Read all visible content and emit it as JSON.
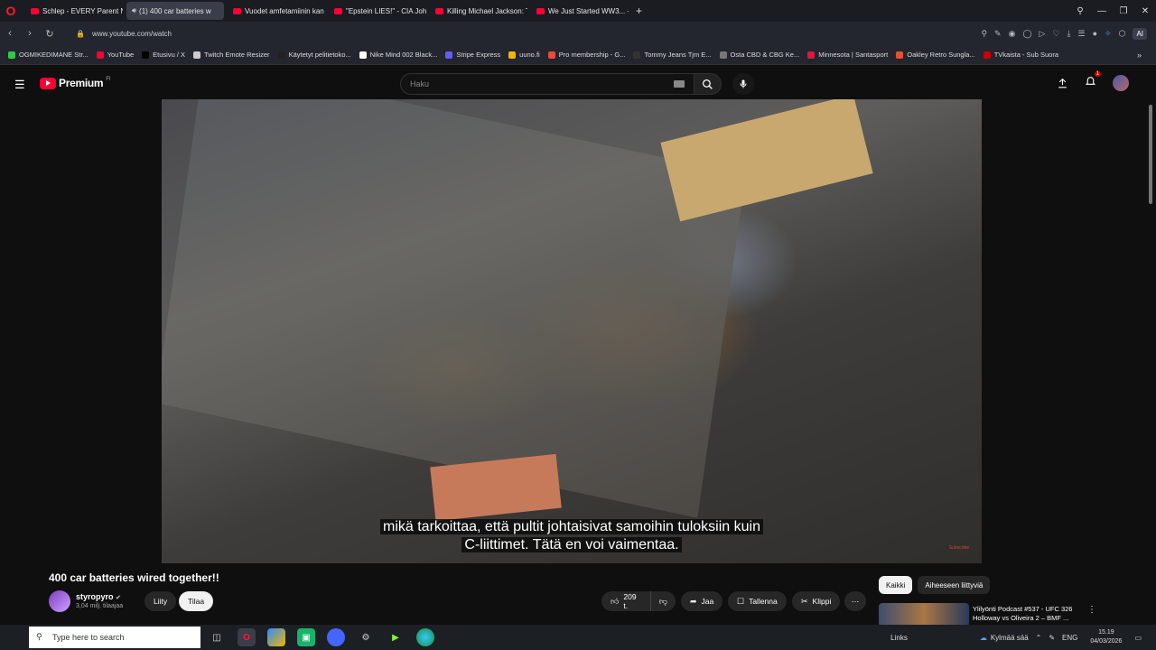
{
  "browser": {
    "tabs": [
      {
        "label": "Schlep - EVERY Parent Ne",
        "active": false,
        "audio": false
      },
      {
        "label": "(1) 400 car batteries w",
        "active": true,
        "audio": true
      },
      {
        "label": "Vuodet amfetamiinin kan",
        "active": false,
        "audio": false
      },
      {
        "label": "\"Epstein LIES!\" - CIA John",
        "active": false,
        "audio": false
      },
      {
        "label": "Killing Michael Jackson: T",
        "active": false,
        "audio": false
      },
      {
        "label": "We Just Started WW3... - Y",
        "active": false,
        "audio": false
      }
    ],
    "new_tab": "+",
    "url": "www.youtube.com/watch",
    "ai_label": "AI",
    "bookmarks": [
      {
        "label": "OGMIKEDIMANE Str...",
        "color": "#2ecc40"
      },
      {
        "label": "YouTube",
        "color": "#ff0033"
      },
      {
        "label": "Etusivu / X",
        "color": "#000000"
      },
      {
        "label": "Twitch Emote Resizer",
        "color": "#cccccc"
      },
      {
        "label": "Käytetyt pelitietoko...",
        "color": "#222222"
      },
      {
        "label": "Nike Mind 002 Black...",
        "color": "#ffffff"
      },
      {
        "label": "Stripe Express",
        "color": "#635bff"
      },
      {
        "label": "uuno.fi",
        "color": "#f5b400"
      },
      {
        "label": "Pro membership - G...",
        "color": "#e74c3c"
      },
      {
        "label": "Tommy Jeans Tjm E...",
        "color": "#333333"
      },
      {
        "label": "Osta CBD & CBG Ke...",
        "color": "#777777"
      },
      {
        "label": "Minnesota | Santasport",
        "color": "#d81b3c"
      },
      {
        "label": "Oakley Retro Sungla...",
        "color": "#e6522c"
      },
      {
        "label": "TVkaista - Sub Suora",
        "color": "#cc0000"
      }
    ]
  },
  "youtube": {
    "brand": "Premium",
    "region": "FI",
    "search_placeholder": "Haku",
    "notification_count": "1"
  },
  "video": {
    "caption_line1": "mikä tarkoittaa, että pultit johtaisivat samoihin tuloksiin kuin",
    "caption_line2": "C-liittimet.  Tätä en voi vaimentaa.",
    "watermark": "Subscribe"
  },
  "meta": {
    "title": "400 car batteries wired together!!",
    "channel": "styropyro",
    "subs": "3,04 milj. tilaajaa",
    "join": "Liity",
    "subscribe": "Tilaa",
    "likes": "209 t.",
    "share": "Jaa",
    "save": "Tallenna",
    "clip": "Klippi",
    "more": "⋯"
  },
  "sidebar": {
    "chips": [
      "Kaikki",
      "Aiheeseen liittyviä"
    ],
    "rec_title": "Ylilyönti Podcast #537 - UFC 326 Holloway vs Oliveira 2 – BMF ..."
  },
  "taskbar": {
    "search_placeholder": "Type here to search",
    "links": "Links",
    "weather": "Kylmää sää",
    "lang": "ENG",
    "time": "15.19",
    "date": "04/03/2026"
  }
}
